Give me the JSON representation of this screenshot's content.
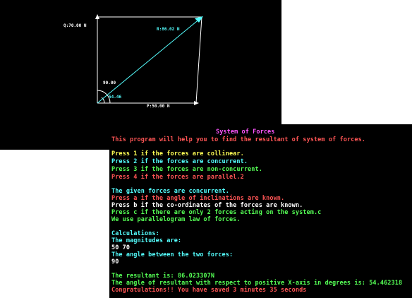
{
  "diagram": {
    "q_label": "Q:70.00 N",
    "r_label": "R:86.02 N",
    "p_label": "P:50.00 N",
    "angle_between_label": "90.00",
    "resultant_angle_label": "54.46",
    "colors": {
      "axes": "#ffffff",
      "resultant": "#55ffff",
      "arc": "#ffffff",
      "angle_label": "#55ffff"
    }
  },
  "console": {
    "title": "System of Forces",
    "intro": "This program will help you to find the resultant of system of forces.",
    "menu": [
      {
        "text": "Press 1 if the forces are collinear.",
        "color": "#ffff55"
      },
      {
        "text": "Press 2 if the forces are concurrent.",
        "color": "#55ffff"
      },
      {
        "text": "Press 3 if the forces are non-concurrent.",
        "color": "#55ff55"
      },
      {
        "text": "Press 4 if the forces are parallel.2",
        "color": "#ff5555"
      }
    ],
    "given": {
      "text": "The given forces are concurrent.",
      "color": "#55ffff"
    },
    "submenu": [
      {
        "text": "Press a if the angle of inclinations are known.",
        "color": "#ff5555"
      },
      {
        "text": "Press b if the co-ordinates of the forces are known.",
        "color": "#ffffff"
      },
      {
        "text": "Press c if there are only 2 forces acting on the system.c",
        "color": "#55ff55"
      },
      {
        "text": "We use parallelogram law of forces.",
        "color": "#55ff55"
      }
    ],
    "calculations": [
      {
        "text": "Calculations:",
        "color": "#55ffff"
      },
      {
        "text": "The magnitudes are:",
        "color": "#55ffff"
      },
      {
        "text": "50 70",
        "color": "#ffffff"
      },
      {
        "text": "The angle between the two forces:",
        "color": "#55ffff"
      },
      {
        "text": "90",
        "color": "#ffffff"
      }
    ],
    "results": [
      {
        "text": "The resultant is: 86.023307N",
        "color": "#55ff55"
      },
      {
        "text": "The angle of resultant with respect to positive X-axis in degrees is: 54.462318",
        "color": "#55ff55"
      },
      {
        "text": "Congratulations!! You have saved 3 minutes 35 seconds",
        "color": "#ff5555"
      }
    ],
    "colors": {
      "title": "#ff55ff",
      "intro": "#ff5555"
    }
  }
}
